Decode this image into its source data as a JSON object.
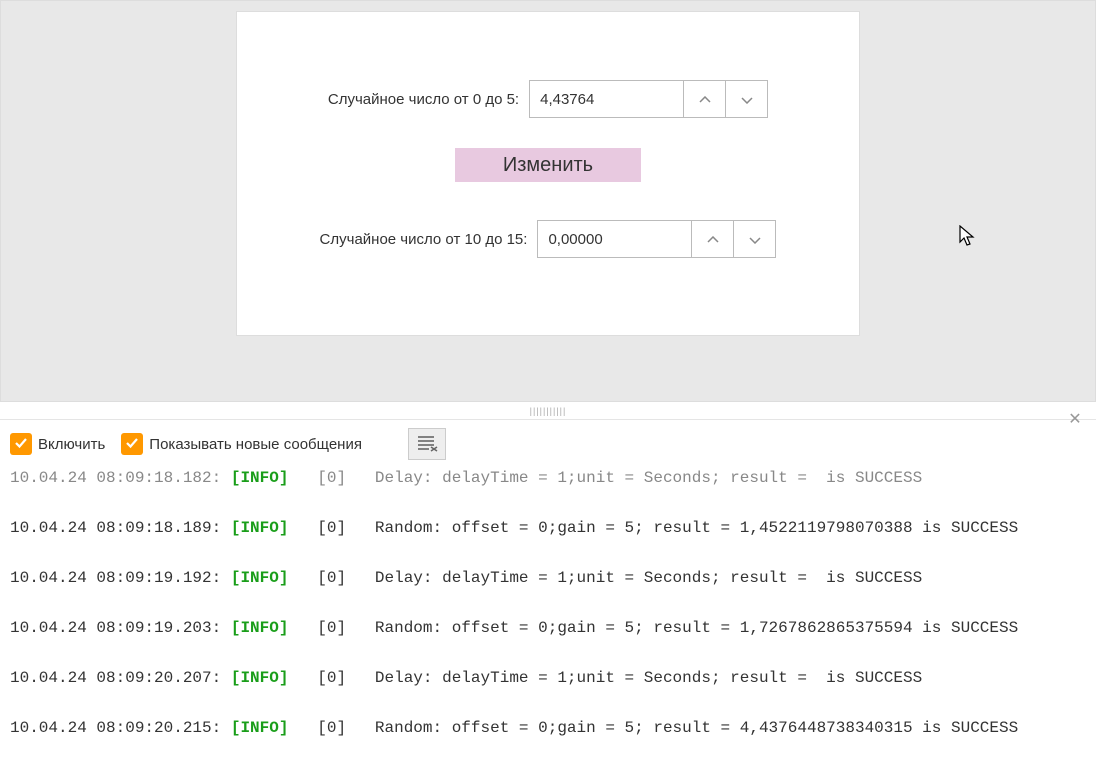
{
  "panel": {
    "row1_label": "Случайное число от 0 до 5:",
    "row1_value": "4,43764",
    "change_label": "Изменить",
    "row2_label": "Случайное число от 10 до 15:",
    "row2_value": "0,00000"
  },
  "toolbar": {
    "enable_label": "Включить",
    "show_new_label": "Показывать новые сообщения"
  },
  "log": {
    "lines": [
      {
        "ts": "10.04.24 08:09:18.182:",
        "lvl": "[INFO]",
        "thr": "[0]",
        "msg": "Delay: delayTime = 1;unit = Seconds; result =  is SUCCESS",
        "cut": true
      },
      {
        "ts": "10.04.24 08:09:18.189:",
        "lvl": "[INFO]",
        "thr": "[0]",
        "msg": "Random: offset = 0;gain = 5; result = 1,4522119798070388 is SUCCESS",
        "cut": false
      },
      {
        "ts": "10.04.24 08:09:19.192:",
        "lvl": "[INFO]",
        "thr": "[0]",
        "msg": "Delay: delayTime = 1;unit = Seconds; result =  is SUCCESS",
        "cut": false
      },
      {
        "ts": "10.04.24 08:09:19.203:",
        "lvl": "[INFO]",
        "thr": "[0]",
        "msg": "Random: offset = 0;gain = 5; result = 1,7267862865375594 is SUCCESS",
        "cut": false
      },
      {
        "ts": "10.04.24 08:09:20.207:",
        "lvl": "[INFO]",
        "thr": "[0]",
        "msg": "Delay: delayTime = 1;unit = Seconds; result =  is SUCCESS",
        "cut": false
      },
      {
        "ts": "10.04.24 08:09:20.215:",
        "lvl": "[INFO]",
        "thr": "[0]",
        "msg": "Random: offset = 0;gain = 5; result = 4,4376448738340315 is SUCCESS",
        "cut": false
      }
    ]
  }
}
